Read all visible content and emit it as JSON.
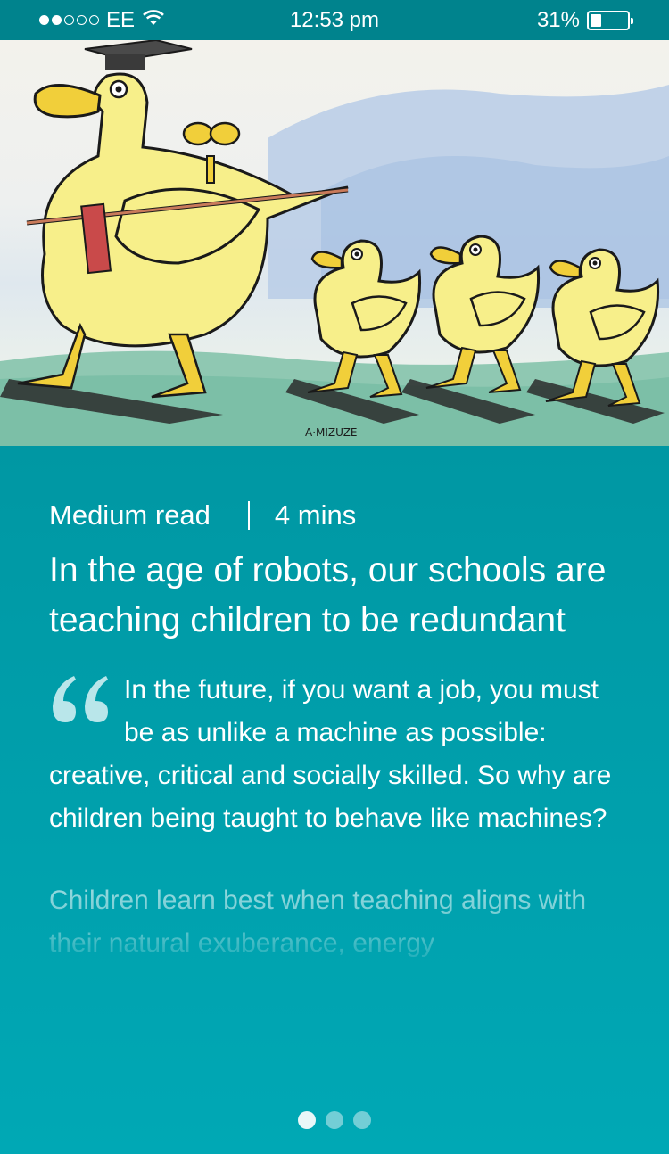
{
  "status_bar": {
    "carrier": "EE",
    "time": "12:53 pm",
    "battery": "31%",
    "battery_level": 0.31,
    "signal_bars_filled": 2,
    "signal_bars_total": 5,
    "wifi_icon": "wifi-icon",
    "battery_icon": "battery-icon"
  },
  "hero": {
    "signature": "A·MIZUZE",
    "description_icon": "illustration-robot-duck-and-ducklings"
  },
  "article": {
    "read_type": "Medium read",
    "duration": "4 mins",
    "headline": "In the age of robots, our schools are teaching children to be redundant",
    "quote": "In the future, if you want a job, you must be as unlike a machine as possible: creative, critical and socially skilled. So why are children being taught to behave like machines?",
    "body_preview": "Children learn best when teaching aligns with their natural exuberance, energy"
  },
  "pager": {
    "total": 3,
    "active_index": 0
  },
  "colors": {
    "background_top": "#008a94",
    "background_bottom": "#00a8b5",
    "status_bar": "#00838d",
    "quote_mark": "#b9e6ea"
  }
}
